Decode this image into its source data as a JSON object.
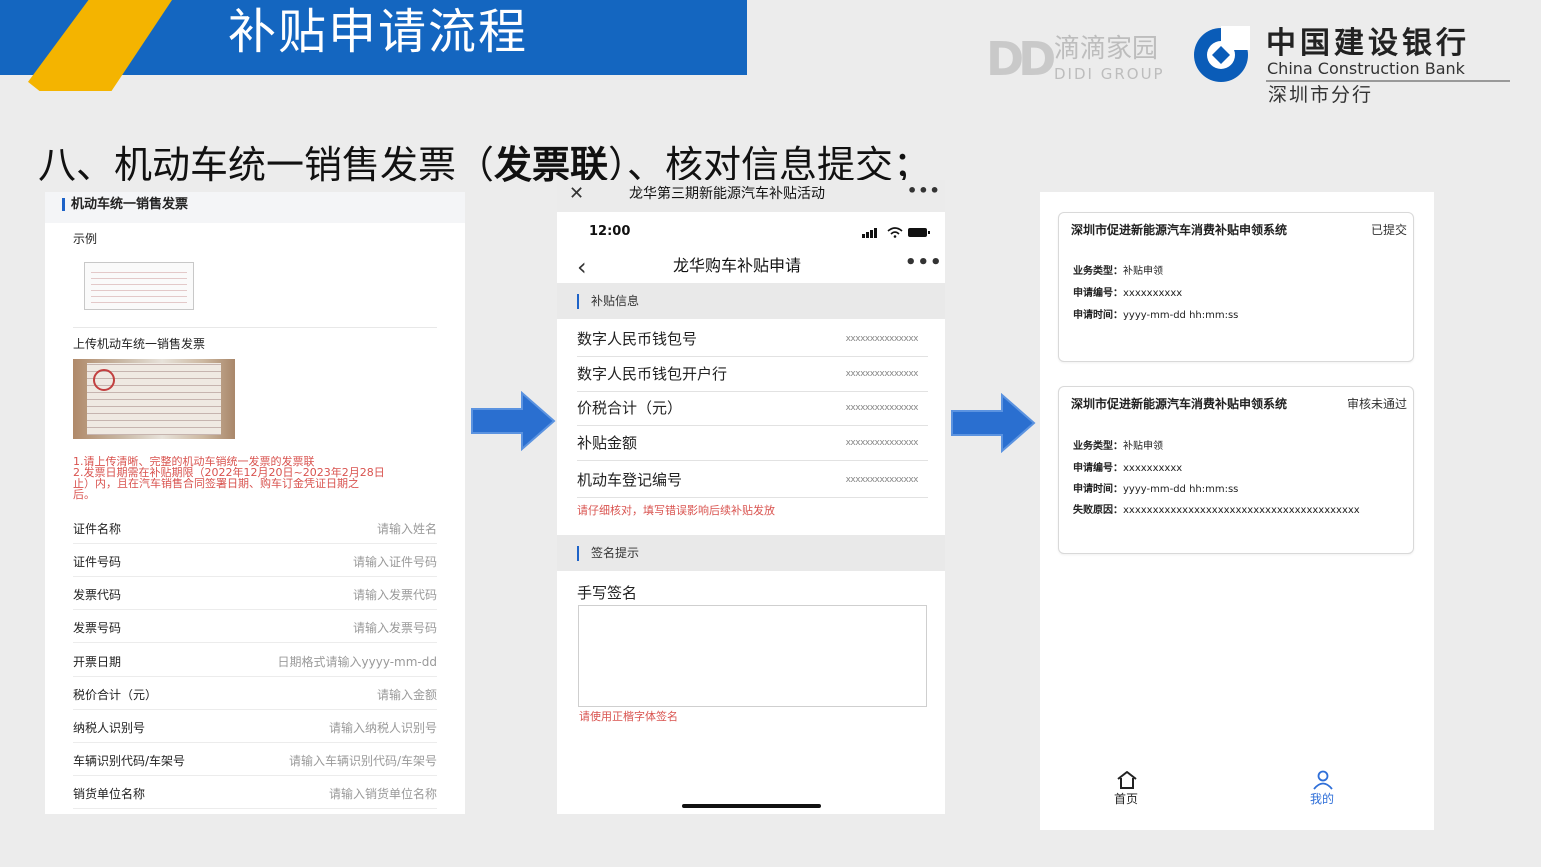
{
  "slide": {
    "title": "补贴申请流程",
    "step_title_pre": "八、机动车统一销售发票（",
    "step_title_bold": "发票联",
    "step_title_post": "）、核对信息提交；"
  },
  "logos": {
    "didi_mark": "DD",
    "didi_cn": "滴滴家园",
    "didi_en": "DIDI GROUP",
    "ccb_cn": "中国建设银行",
    "ccb_en": "China Construction Bank",
    "ccb_branch": "深圳市分行",
    "ccb_color": "#0a5cb8"
  },
  "panel1": {
    "header": "机动车统一销售发票",
    "example_label": "示例",
    "upload_label": "上传机动车统一销售发票",
    "notes": [
      "1.请上传清晰、完整的机动车销统一发票的发票联",
      "2.发票日期需在补贴期限（2022年12月20日~2023年2月28日",
      "止）内，且在汽车销售合同签署日期、购车订金凭证日期之",
      "后。"
    ],
    "fields": [
      {
        "label": "证件名称",
        "placeholder": "请输入姓名"
      },
      {
        "label": "证件号码",
        "placeholder": "请输入证件号码"
      },
      {
        "label": "发票代码",
        "placeholder": "请输入发票代码"
      },
      {
        "label": "发票号码",
        "placeholder": "请输入发票号码"
      },
      {
        "label": "开票日期",
        "placeholder": "日期格式请输入yyyy-mm-dd"
      },
      {
        "label": "税价合计（元）",
        "placeholder": "请输入金额"
      },
      {
        "label": "纳税人识别号",
        "placeholder": "请输入纳税人识别号"
      },
      {
        "label": "车辆识别代码/车架号",
        "placeholder": "请输入车辆识别代码/车架号"
      },
      {
        "label": "销货单位名称",
        "placeholder": "请输入销货单位名称"
      }
    ]
  },
  "panel2": {
    "top_title": "龙华第三期新能源汽车补贴活动",
    "top_dots": "•••",
    "time": "12:00",
    "nav_title": "龙华购车补贴申请",
    "nav_dots": "•••",
    "section1": "补贴信息",
    "rows": [
      {
        "label": "数字人民币钱包号",
        "value": "xxxxxxxxxxxxxxx"
      },
      {
        "label": "数字人民币钱包开户行",
        "value": "xxxxxxxxxxxxxxx"
      },
      {
        "label": "价税合计（元）",
        "value": "xxxxxxxxxxxxxxx"
      },
      {
        "label": "补贴金额",
        "value": "xxxxxxxxxxxxxxx"
      },
      {
        "label": "机动车登记编号",
        "value": "xxxxxxxxxxxxxxx"
      }
    ],
    "warning": "请仔细核对，填写错误影响后续补贴发放",
    "section2": "签名提示",
    "signature_label": "手写签名",
    "signature_hint": "请使用正楷字体签名"
  },
  "panel3": {
    "cards": [
      {
        "title": "深圳市促进新能源汽车消费补贴申领系统",
        "status": "已提交",
        "lines": [
          {
            "k": "业务类型：",
            "v": "补贴申领"
          },
          {
            "k": "申请编号：",
            "v": "xxxxxxxxxx"
          },
          {
            "k": "申请时间：",
            "v": "yyyy-mm-dd hh:mm:ss"
          }
        ]
      },
      {
        "title": "深圳市促进新能源汽车消费补贴申领系统",
        "status": "审核未通过",
        "lines": [
          {
            "k": "业务类型：",
            "v": "补贴申领"
          },
          {
            "k": "申请编号：",
            "v": "xxxxxxxxxx"
          },
          {
            "k": "申请时间：",
            "v": "yyyy-mm-dd hh:mm:ss"
          },
          {
            "k": "失败原因：",
            "v": "xxxxxxxxxxxxxxxxxxxxxxxxxxxxxxxxxxxxxxxx"
          }
        ]
      }
    ],
    "tabs": [
      {
        "label": "首页",
        "icon": "home-icon"
      },
      {
        "label": "我的",
        "icon": "user-icon"
      }
    ]
  },
  "colors": {
    "header_blue": "#1466c0",
    "header_yellow": "#f4b400",
    "arrow_blue": "#2a6fd0",
    "warning_red": "#d9534f",
    "active_tab": "#2f6fd8"
  }
}
